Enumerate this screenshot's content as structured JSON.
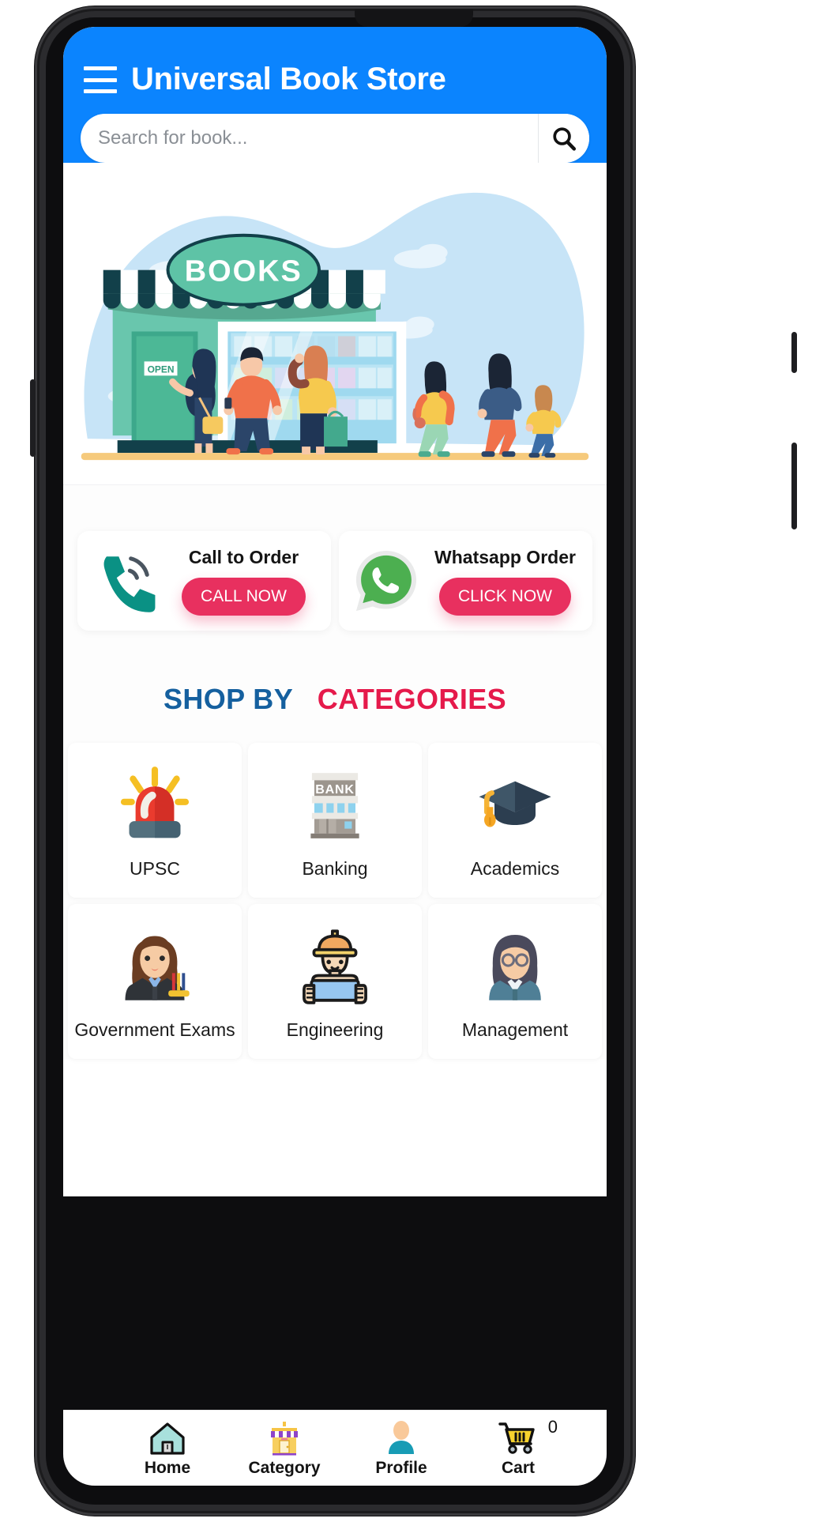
{
  "app": {
    "title": "Universal Book Store",
    "menu_icon": "hamburger-icon"
  },
  "search": {
    "placeholder": "Search for book...",
    "value": "",
    "icon": "search-icon"
  },
  "hero": {
    "shop_sign": "BOOKS",
    "door_sign": "OPEN",
    "alt": "book store front illustration with shoppers"
  },
  "contact": {
    "cards": [
      {
        "icon": "phone-call-icon",
        "title": "Call to Order",
        "button": "CALL NOW"
      },
      {
        "icon": "whatsapp-icon",
        "title": "Whatsapp Order",
        "button": "CLICK NOW"
      }
    ],
    "button_color": "#e8305f"
  },
  "section": {
    "heading_part1": "SHOP BY",
    "heading_part2": "CATEGORIES",
    "color1": "#15609f",
    "color2": "#e51a4b"
  },
  "categories": [
    {
      "label": "UPSC",
      "icon": "siren-icon"
    },
    {
      "label": "Banking",
      "icon": "bank-building-icon"
    },
    {
      "label": "Academics",
      "icon": "graduation-cap-icon"
    },
    {
      "label": "Government Exams",
      "icon": "officer-woman-icon"
    },
    {
      "label": "Engineering",
      "icon": "engineer-icon"
    },
    {
      "label": "Management",
      "icon": "manager-woman-icon"
    }
  ],
  "bottom_nav": {
    "items": [
      {
        "label": "Home",
        "icon": "home-icon"
      },
      {
        "label": "Category",
        "icon": "shop-icon"
      },
      {
        "label": "Profile",
        "icon": "person-icon"
      },
      {
        "label": "Cart",
        "icon": "cart-icon",
        "badge": "0"
      }
    ]
  },
  "theme": {
    "appbar": "#0b84fe",
    "accent_pink": "#e8305f",
    "whatsapp_green": "#4caf50",
    "phone_teal": "#009688"
  }
}
